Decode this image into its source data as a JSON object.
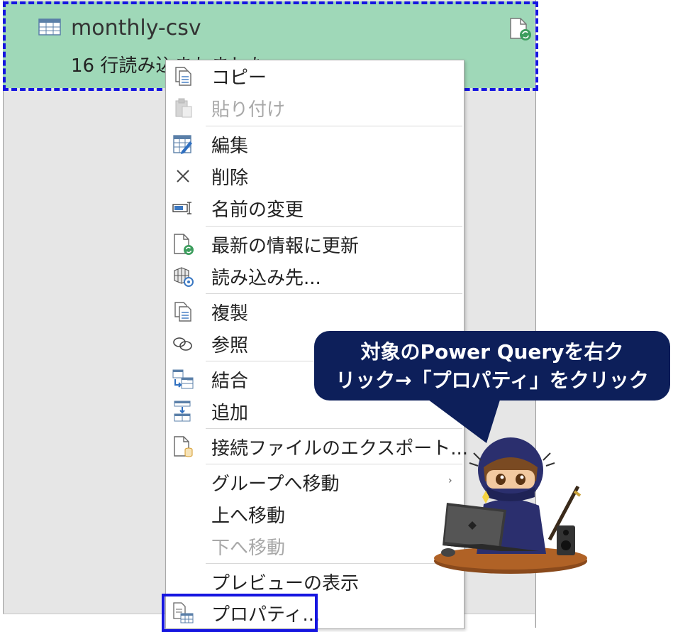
{
  "query": {
    "name": "monthly-csv",
    "status": "16 行読み込まれました",
    "icon": "table-icon",
    "right_icon": "refresh-file-icon"
  },
  "menu": {
    "items": [
      {
        "label": "コピー",
        "icon": "copy-icon",
        "enabled": true
      },
      {
        "label": "貼り付け",
        "icon": "paste-icon",
        "enabled": false
      },
      {
        "label": "編集",
        "icon": "edit-table-icon",
        "enabled": true
      },
      {
        "label": "削除",
        "icon": "delete-x-icon",
        "enabled": true
      },
      {
        "label": "名前の変更",
        "icon": "rename-icon",
        "enabled": true
      },
      {
        "label": "最新の情報に更新",
        "icon": "refresh-icon",
        "enabled": true
      },
      {
        "label": "読み込み先...",
        "icon": "load-to-icon",
        "enabled": true
      },
      {
        "label": "複製",
        "icon": "duplicate-icon",
        "enabled": true
      },
      {
        "label": "参照",
        "icon": "reference-icon",
        "enabled": true
      },
      {
        "label": "結合",
        "icon": "merge-icon",
        "enabled": true
      },
      {
        "label": "追加",
        "icon": "append-icon",
        "enabled": true
      },
      {
        "label": "接続ファイルのエクスポート...",
        "icon": "export-connection-icon",
        "enabled": true
      },
      {
        "label": "グループへ移動",
        "icon": "",
        "enabled": true,
        "submenu": true
      },
      {
        "label": "上へ移動",
        "icon": "",
        "enabled": true
      },
      {
        "label": "下へ移動",
        "icon": "",
        "enabled": false
      },
      {
        "label": "プレビューの表示",
        "icon": "",
        "enabled": true
      },
      {
        "label": "プロパティ...",
        "icon": "properties-icon",
        "enabled": true,
        "highlighted": true
      }
    ],
    "submenu_arrow": "›"
  },
  "callout": {
    "line1": "対象のPower Queryを右ク",
    "line2": "リック→「プロパティ」をクリック"
  },
  "colors": {
    "selected_bg": "#9fd8b8",
    "highlight_border": "#1515e0",
    "callout_bg": "#0d1f5a",
    "disabled_text": "#a8a8a8"
  }
}
